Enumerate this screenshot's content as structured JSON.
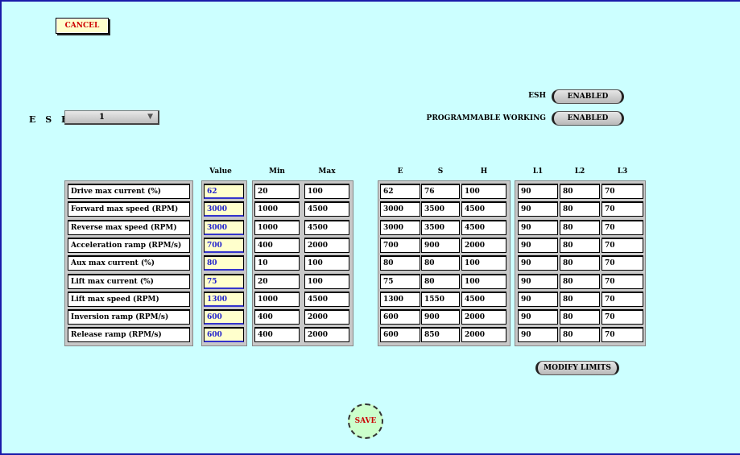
{
  "buttons": {
    "cancel": "CANCEL",
    "modify_limits": "MODIFY LIMITS",
    "save": "SAVE"
  },
  "esh": {
    "label": "E S H",
    "selected": "1"
  },
  "toggles": [
    {
      "label": "ESH",
      "value": "ENABLED"
    },
    {
      "label": "PROGRAMMABLE WORKING",
      "value": "ENABLED"
    }
  ],
  "table": {
    "headers": {
      "value": "Value",
      "min": "Min",
      "max": "Max",
      "e": "E",
      "s": "S",
      "h": "H",
      "l1": "L1",
      "l2": "L2",
      "l3": "L3"
    },
    "rows": [
      {
        "label": "Drive max current (%)",
        "value": "62",
        "min": "20",
        "max": "100",
        "e": "62",
        "s": "76",
        "h": "100",
        "l1": "90",
        "l2": "80",
        "l3": "70"
      },
      {
        "label": "Forward max speed (RPM)",
        "value": "3000",
        "min": "1000",
        "max": "4500",
        "e": "3000",
        "s": "3500",
        "h": "4500",
        "l1": "90",
        "l2": "80",
        "l3": "70"
      },
      {
        "label": "Reverse max speed (RPM)",
        "value": "3000",
        "min": "1000",
        "max": "4500",
        "e": "3000",
        "s": "3500",
        "h": "4500",
        "l1": "90",
        "l2": "80",
        "l3": "70"
      },
      {
        "label": "Acceleration ramp (RPM/s)",
        "value": "700",
        "min": "400",
        "max": "2000",
        "e": "700",
        "s": "900",
        "h": "2000",
        "l1": "90",
        "l2": "80",
        "l3": "70"
      },
      {
        "label": "Aux max current (%)",
        "value": "80",
        "min": "10",
        "max": "100",
        "e": "80",
        "s": "80",
        "h": "100",
        "l1": "90",
        "l2": "80",
        "l3": "70"
      },
      {
        "label": "Lift max current (%)",
        "value": "75",
        "min": "20",
        "max": "100",
        "e": "75",
        "s": "80",
        "h": "100",
        "l1": "90",
        "l2": "80",
        "l3": "70"
      },
      {
        "label": "Lift max speed (RPM)",
        "value": "1300",
        "min": "1000",
        "max": "4500",
        "e": "1300",
        "s": "1550",
        "h": "4500",
        "l1": "90",
        "l2": "80",
        "l3": "70"
      },
      {
        "label": "Inversion ramp (RPM/s)",
        "value": "600",
        "min": "400",
        "max": "2000",
        "e": "600",
        "s": "900",
        "h": "2000",
        "l1": "90",
        "l2": "80",
        "l3": "70"
      },
      {
        "label": "Release ramp (RPM/s)",
        "value": "600",
        "min": "400",
        "max": "2000",
        "e": "600",
        "s": "850",
        "h": "2000",
        "l1": "90",
        "l2": "80",
        "l3": "70"
      }
    ]
  }
}
